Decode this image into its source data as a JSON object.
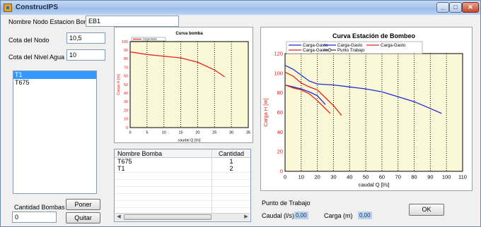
{
  "window": {
    "title": "ConstrucIPS"
  },
  "form": {
    "nodo_label": "Nombre Nodo Estacion Bombeo",
    "nodo_value": "EB1",
    "cota_label": "Cota del Nodo",
    "cota_value": "10,5",
    "nivel_label": "Cota del Nivel Agua",
    "nivel_value": "10",
    "cantidad_label": "Cantidad Bombas",
    "cantidad_value": "0",
    "poner_button": "Poner",
    "quitar_button": "Quitar",
    "ok_button": "OK"
  },
  "bombas_list": [
    "T1",
    "T675"
  ],
  "bombas_grid": {
    "headers": [
      "Nombre Bomba",
      "Cantidad"
    ],
    "rows": [
      {
        "nombre": "T675",
        "cantidad": "1"
      },
      {
        "nombre": "T1",
        "cantidad": "2"
      }
    ]
  },
  "punto_trabajo": {
    "section_label": "Punto de Trabajo",
    "caudal_label": "Caudal  (l/s)",
    "caudal_value": "0,00",
    "carga_label": "Carga  (m)",
    "carga_value": "0,00"
  },
  "colors": {
    "red": "#e8201a",
    "blue": "#1a2fd6",
    "plot_bg": "#fbf8d8"
  },
  "chart_data": [
    {
      "type": "line",
      "title": "Curva bomba",
      "xlabel": "caudal Q [l/s]",
      "ylabel": "Carga H [m]",
      "xlim": [
        0,
        35
      ],
      "ylim": [
        0,
        100
      ],
      "x_ticks": [
        0,
        5,
        10,
        15,
        20,
        25,
        30,
        35
      ],
      "y_ticks": [
        0,
        10,
        20,
        30,
        40,
        50,
        60,
        70,
        80,
        90,
        100
      ],
      "grid": true,
      "legend": "top-left",
      "series": [
        {
          "name": "Carga-Gasto",
          "color": "#e8201a",
          "x": [
            0,
            5,
            10,
            15,
            20,
            25,
            28
          ],
          "y": [
            88,
            85,
            83,
            81,
            76,
            67,
            59
          ]
        }
      ]
    },
    {
      "type": "line",
      "title": "Curva Estación de Bombeo",
      "xlabel": "caudal Q [l/s]",
      "ylabel": "Carga H [m]",
      "xlim": [
        0,
        110
      ],
      "ylim": [
        0,
        120
      ],
      "x_ticks": [
        0,
        10,
        20,
        30,
        40,
        50,
        60,
        70,
        80,
        90,
        100,
        110
      ],
      "y_ticks": [
        0,
        20,
        40,
        60,
        80,
        100,
        120
      ],
      "grid": true,
      "legend": "top",
      "series": [
        {
          "name": "Carga-Gasto",
          "color": "#1a2fd6",
          "x": [
            0,
            5,
            10,
            15,
            20,
            30,
            40,
            50,
            60,
            70,
            80,
            90,
            97
          ],
          "y": [
            108,
            104,
            98,
            92,
            89,
            88,
            86,
            84,
            81,
            76,
            71,
            64,
            59
          ]
        },
        {
          "name": "Carga-Gasto",
          "color": "#1a2fd6",
          "x": [
            0,
            5,
            10,
            15,
            20,
            25
          ],
          "y": [
            88,
            86,
            84,
            81,
            77,
            68
          ]
        },
        {
          "name": "Carga-Gasto",
          "color": "#e8201a",
          "x": [
            0,
            5,
            10,
            15,
            20,
            28
          ],
          "y": [
            88,
            85,
            83,
            79,
            72,
            59
          ]
        },
        {
          "name": "Carga-Gasto",
          "color": "#e8201a",
          "x": [
            0,
            5,
            10,
            15,
            20,
            25,
            30,
            35
          ],
          "y": [
            101,
            97,
            90,
            86,
            83,
            75,
            67,
            57
          ]
        },
        {
          "name": "Punto Trabajo",
          "color": "#404040",
          "x": [],
          "y": []
        }
      ]
    }
  ]
}
